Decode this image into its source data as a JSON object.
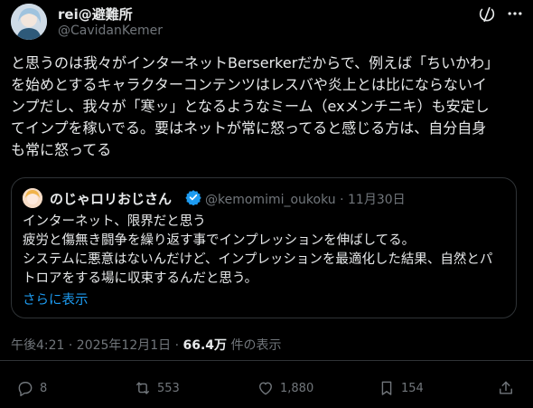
{
  "tweet": {
    "author": {
      "display_name": "rei@避難所",
      "handle": "@CavidanKemer"
    },
    "body": "と思うのは我々がインターネットBerserkerだからで、例えば「ちいかわ」\nを始めとするキャラクターコンテンツはレスバや炎上とは比にならないイ\nンプだし、我々が「寒ッ」となるようなミーム（exメンチニキ）も安定し\nてインプを稼いでる。要はネットが常に怒ってると感じる方は、自分自身\nも常に怒ってる",
    "quote": {
      "display_name": "のじゃロリおじさん",
      "handle": "@kemomimi_oukoku",
      "separator": "·",
      "date": "11月30日",
      "text": "インターネット、限界だと思う\n疲労と傷無き闘争を繰り返す事でインプレッションを伸ばしてる。\nシステムに悪意はないんだけど、インプレッションを最適化した結果、自然とパ\nトロアをする場に収束するんだと思う。",
      "show_more": "さらに表示"
    },
    "meta": {
      "time": "午後4:21 · 2025年12月1日 · ",
      "views": "66.4万",
      "views_label": " 件の表示"
    },
    "actions": {
      "replies": "8",
      "reposts": "553",
      "likes": "1,880",
      "bookmarks": "154"
    }
  },
  "icons": {
    "top_right": [
      "grok-slash-icon",
      "more-icon"
    ],
    "actions": [
      "reply-icon",
      "repost-icon",
      "like-icon",
      "bookmark-icon",
      "share-icon"
    ]
  },
  "colors": {
    "background": "#000000",
    "text": "#e7e9ea",
    "muted": "#71767b",
    "link": "#1d9bf0",
    "border": "#2f3336"
  }
}
